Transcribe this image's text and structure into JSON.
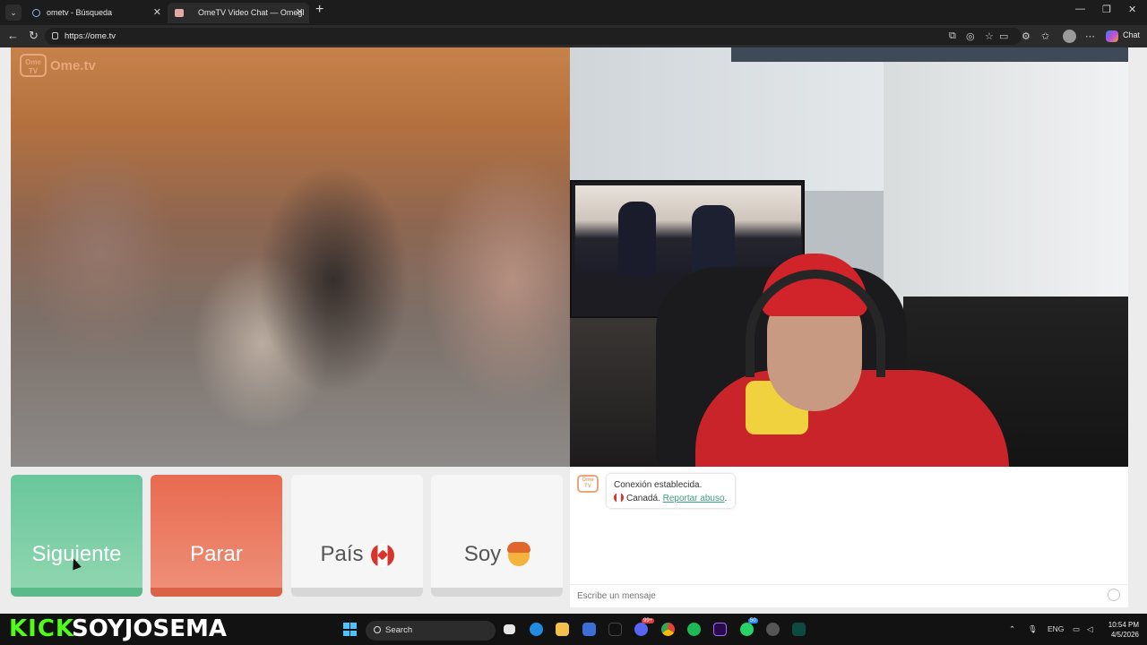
{
  "browser": {
    "tabs": [
      {
        "title": "ometv - Búsqueda"
      },
      {
        "title": "OmeTV Video Chat — Omegl"
      }
    ],
    "url": "https://ome.tv",
    "chat_button": "Chat"
  },
  "site": {
    "logo_badge": "Ome TV",
    "logo_text": "Ome.tv"
  },
  "buttons": {
    "next": "Siguiente",
    "stop": "Parar",
    "country": "País",
    "gender": "Soy"
  },
  "chat": {
    "logo_badge": "Ome TV",
    "status": "Conexión establecida.",
    "country": "Canadá.",
    "report_link": "Reportar abuso",
    "report_suffix": ".",
    "input_placeholder": "Escribe un mensaje"
  },
  "overlay": {
    "platform": "KICK",
    "streamer": "SOYJOSEMA"
  },
  "taskbar": {
    "search_label": "Search",
    "language": "ENG",
    "time": "10:54 PM",
    "date": "4/5/2026",
    "badges": [
      "99+",
      "50"
    ]
  },
  "colors": {
    "next": "#69c69b",
    "stop": "#e86a4f",
    "kick_green": "#53fc18",
    "ome_orange": "#e9a57b"
  }
}
